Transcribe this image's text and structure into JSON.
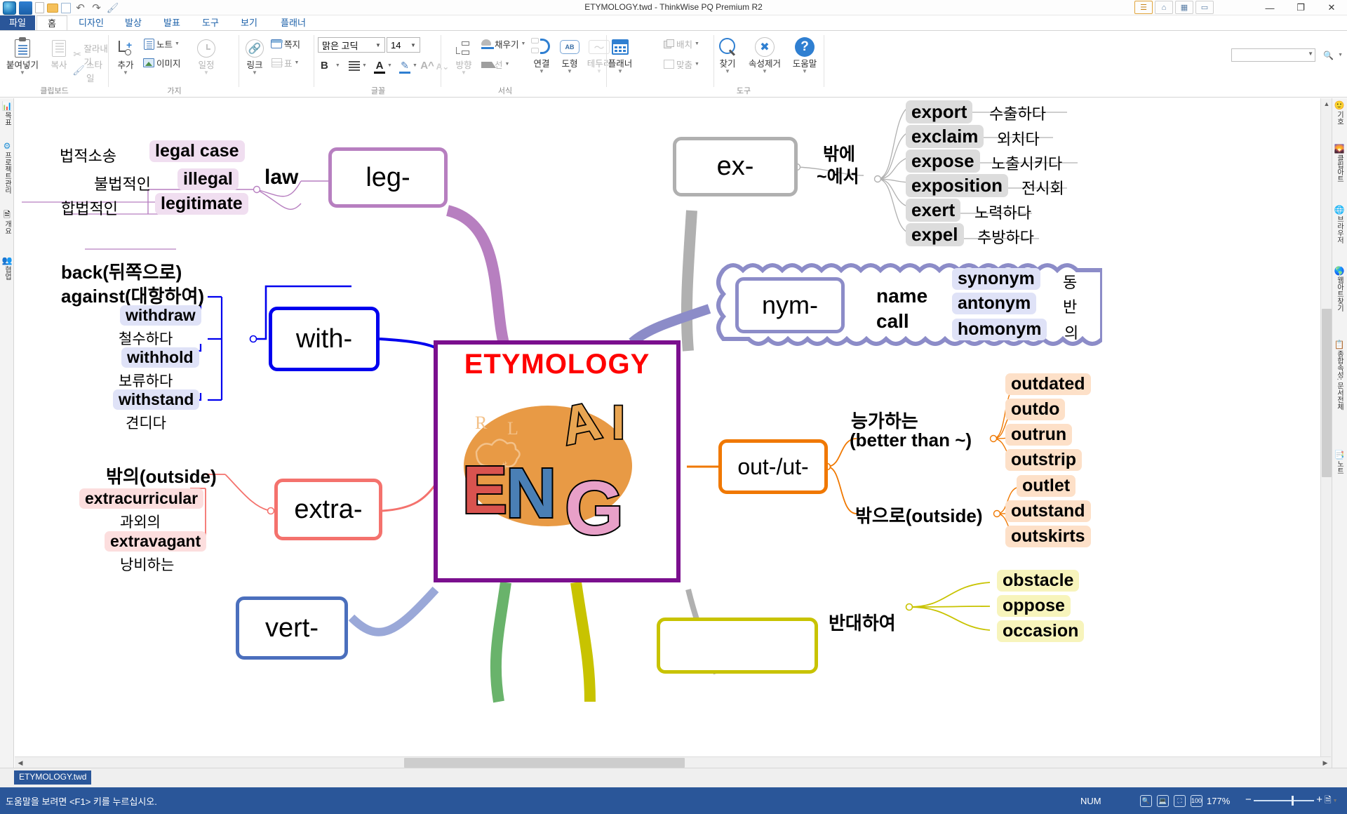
{
  "window": {
    "title": "ETYMOLOGY.twd - ThinkWise PQ Premium R2",
    "minimize": "—",
    "maximize": "❐",
    "close": "✕"
  },
  "quick_access": [
    {
      "name": "app-logo",
      "glyph": ""
    },
    {
      "name": "new-map-icon",
      "glyph": ""
    },
    {
      "name": "new-document-icon",
      "glyph": ""
    },
    {
      "name": "open-folder-icon",
      "glyph": ""
    },
    {
      "name": "save-icon",
      "glyph": ""
    },
    {
      "name": "undo-icon",
      "glyph": "↶"
    },
    {
      "name": "redo-icon",
      "glyph": "↷"
    },
    {
      "name": "format-painter-icon",
      "glyph": "🖌"
    }
  ],
  "ribbon_mini": [
    "☰",
    "⌂",
    "▦",
    "▭"
  ],
  "tabs": [
    {
      "label": "파일",
      "type": "file"
    },
    {
      "label": "홈",
      "type": "active"
    },
    {
      "label": "디자인",
      "type": "normal"
    },
    {
      "label": "발상",
      "type": "normal"
    },
    {
      "label": "발표",
      "type": "normal"
    },
    {
      "label": "도구",
      "type": "normal"
    },
    {
      "label": "보기",
      "type": "normal"
    },
    {
      "label": "플래너",
      "type": "normal"
    }
  ],
  "ribbon": {
    "groups": [
      {
        "label": "클립보드"
      },
      {
        "label": "가지"
      },
      {
        "label": "글꼴"
      },
      {
        "label": "서식"
      },
      {
        "label": "도구"
      }
    ],
    "clipboard": {
      "paste": "붙여넣기",
      "copy": "복사",
      "cut": "잘라내기",
      "style": "스타일"
    },
    "branch": {
      "add": "추가",
      "note": "노트",
      "image": "이미지",
      "schedule": "일정",
      "link": "링크",
      "memo": "쪽지",
      "table": "표"
    },
    "font": {
      "family": "맑은 고딕",
      "size": "14",
      "bold": "B"
    },
    "format": {
      "direction": "방향",
      "fill": "채우기",
      "line": "선",
      "connect": "연결",
      "shape": "도형",
      "shape_glyph": "AB",
      "border": "테두리"
    },
    "tools": {
      "planner": "플래너",
      "arrange": "배치",
      "align": "맞춤",
      "find": "찾기",
      "clear_attr": "속성제거",
      "help": "도움말"
    }
  },
  "left_sidebar": [
    {
      "label": "목표",
      "icon": "target-icon"
    },
    {
      "label": "프로젝트관리",
      "icon": "gear-icon"
    },
    {
      "label": "개요",
      "icon": "outline-icon"
    },
    {
      "label": "협업",
      "icon": "people-icon"
    }
  ],
  "right_sidebar": [
    {
      "label": "기호",
      "icon": "smiley-icon"
    },
    {
      "label": "클립아트",
      "icon": "picture-icon"
    },
    {
      "label": "브라우저",
      "icon": "globe-icon"
    },
    {
      "label": "웹아트찾기",
      "icon": "web-globe-icon"
    },
    {
      "label": "종합속성: 문서전체",
      "icon": "clipboard-icon"
    },
    {
      "label": "노트",
      "icon": "note-icon"
    }
  ],
  "mindmap": {
    "center": {
      "title": "ETYMOLOGY",
      "letters": [
        "R",
        "L",
        "A",
        "I",
        "E",
        "N",
        "G"
      ],
      "border_color": "#7b0f8e",
      "title_color": "#ff0000"
    },
    "branches": [
      {
        "id": "leg",
        "label": "leg-",
        "color": "#b77fc0",
        "meaning": "law",
        "children": [
          {
            "word": "legal case",
            "kr": "법적소송"
          },
          {
            "word": "illegal",
            "kr": "불법적인"
          },
          {
            "word": "legitimate",
            "kr": "합법적인"
          }
        ]
      },
      {
        "id": "ex",
        "label": "ex-",
        "color": "#b0b0b0",
        "meaning": "밖에\n~에서",
        "meaning_l1": "밖에",
        "meaning_l2": "~에서",
        "children": [
          {
            "word": "export",
            "kr": "수출하다"
          },
          {
            "word": "exclaim",
            "kr": "외치다"
          },
          {
            "word": "expose",
            "kr": "노출시키다"
          },
          {
            "word": "exposition",
            "kr": "전시회"
          },
          {
            "word": "exert",
            "kr": "노력하다"
          },
          {
            "word": "expel",
            "kr": "추방하다"
          }
        ]
      },
      {
        "id": "with",
        "label": "with-",
        "color": "#0000ee",
        "meaning_l1": "back(뒤쪽으로)",
        "meaning_l2": "against(대항하여)",
        "children": [
          {
            "word": "withdraw",
            "kr": "철수하다"
          },
          {
            "word": "withhold",
            "kr": "보류하다"
          },
          {
            "word": "withstand",
            "kr": "견디다"
          }
        ]
      },
      {
        "id": "nym",
        "label": "nym-",
        "color": "#8c8cc8",
        "meaning_l1": "name",
        "meaning_l2": "call",
        "children": [
          {
            "word": "synonym",
            "kr": "동"
          },
          {
            "word": "antonym",
            "kr": "반"
          },
          {
            "word": "homonym",
            "kr": "의"
          }
        ]
      },
      {
        "id": "extra",
        "label": "extra-",
        "color": "#f4726d",
        "meaning_l1": "밖의(outside)",
        "children": [
          {
            "word": "extracurricular",
            "kr": "과외의"
          },
          {
            "word": "extravagant",
            "kr": "낭비하는"
          }
        ]
      },
      {
        "id": "out",
        "label": "out-/ut-",
        "color": "#f07800",
        "meaning_l1": "능가하는",
        "meaning_l2": "(better than ~)",
        "meaning_l3": "밖으로(outside)",
        "children_a": [
          {
            "word": "outdated"
          },
          {
            "word": "outdo"
          },
          {
            "word": "outrun"
          },
          {
            "word": "outstrip"
          }
        ],
        "children_b": [
          {
            "word": "outlet"
          },
          {
            "word": "outstand"
          },
          {
            "word": "outskirts"
          }
        ]
      },
      {
        "id": "vert",
        "label": "vert-",
        "color": "#4b6fbd"
      },
      {
        "id": "ob",
        "label": "",
        "color": "#c8c300",
        "meaning_l1": "반대하여",
        "children": [
          {
            "word": "obstacle"
          },
          {
            "word": "oppose"
          },
          {
            "word": "occasion"
          }
        ]
      }
    ]
  },
  "doc_tab": "ETYMOLOGY.twd",
  "statusbar": {
    "help_text": "도움말을 보려면 <F1> 키를 누르십시오.",
    "num": "NUM",
    "zoom": "177%",
    "zoom_minus": "−",
    "zoom_plus": "+"
  }
}
